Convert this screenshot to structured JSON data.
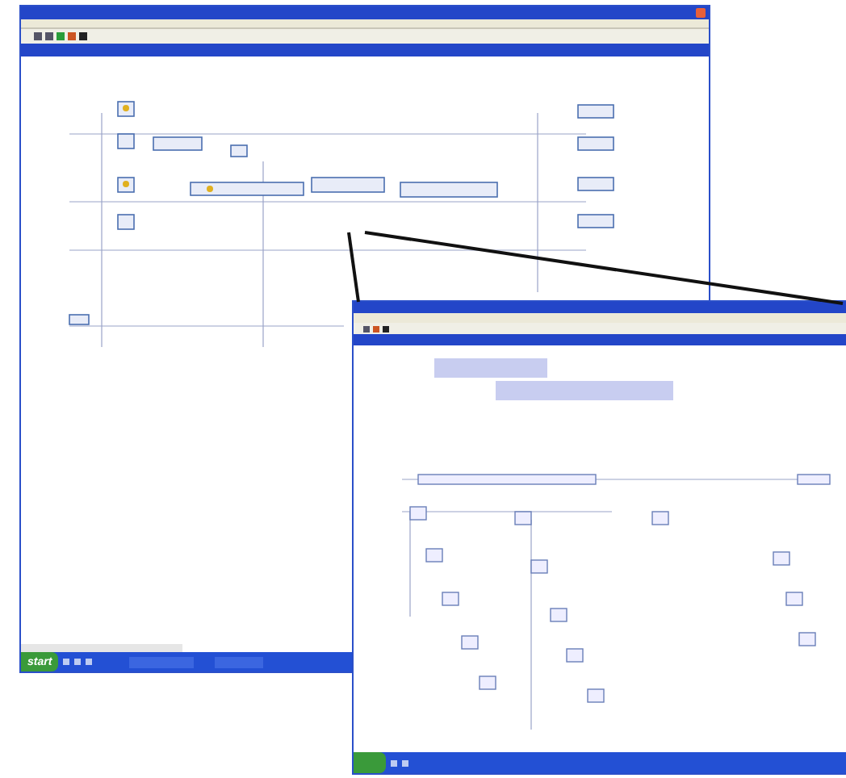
{
  "taskbar": {
    "start_button": "start"
  }
}
